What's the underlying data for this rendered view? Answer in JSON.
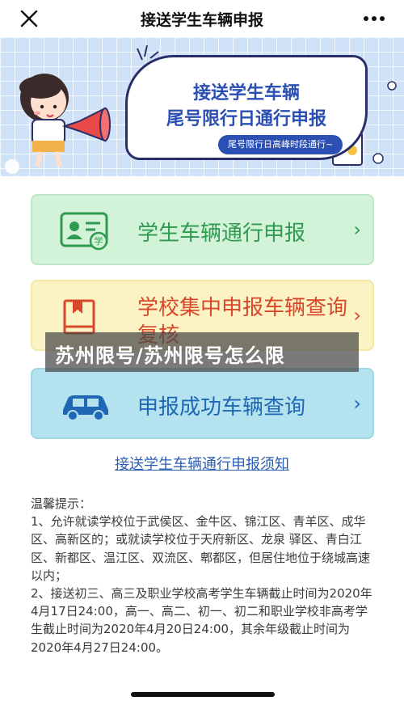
{
  "nav": {
    "title": "接送学生车辆申报",
    "close_icon": "close-icon",
    "more_icon": "more-icon"
  },
  "banner": {
    "title_line1": "接送学生车辆",
    "title_line2": "尾号限行日通行申报",
    "pill": "尾号限行日高峰时段通行~"
  },
  "menu": {
    "items": [
      {
        "label": "学生车辆通行申报",
        "icon": "student-id-card-icon",
        "color": "#2f9a50"
      },
      {
        "label": "学校集中申报车辆查询复核",
        "icon": "book-icon",
        "color": "#d9472a"
      },
      {
        "label": "申报成功车辆查询",
        "icon": "car-icon",
        "color": "#1f66b5"
      }
    ],
    "chevron": "›"
  },
  "overlay": {
    "text": "苏州限号/苏州限号怎么限"
  },
  "notice": {
    "link": "接送学生车辆通行申报须知"
  },
  "tips": {
    "heading": "温馨提示：",
    "item1": "1、允许就读学校位于武侯区、金牛区、锦江区、青羊区、成华区、高新区的；或就读学校位于天府新区、龙泉 驿区、青白江区、新都区、温江区、双流区、郫都区，但居住地位于绕城高速以内；",
    "item2": "2、接送初三、高三及职业学校高考学生车辆截止时间为2020年4月17日24:00，高一、高二、初一、初二和职业学校非高考学生截止时间为2020年4月20日24:00，其余年级截止时间为2020年4月27日24:00。"
  }
}
